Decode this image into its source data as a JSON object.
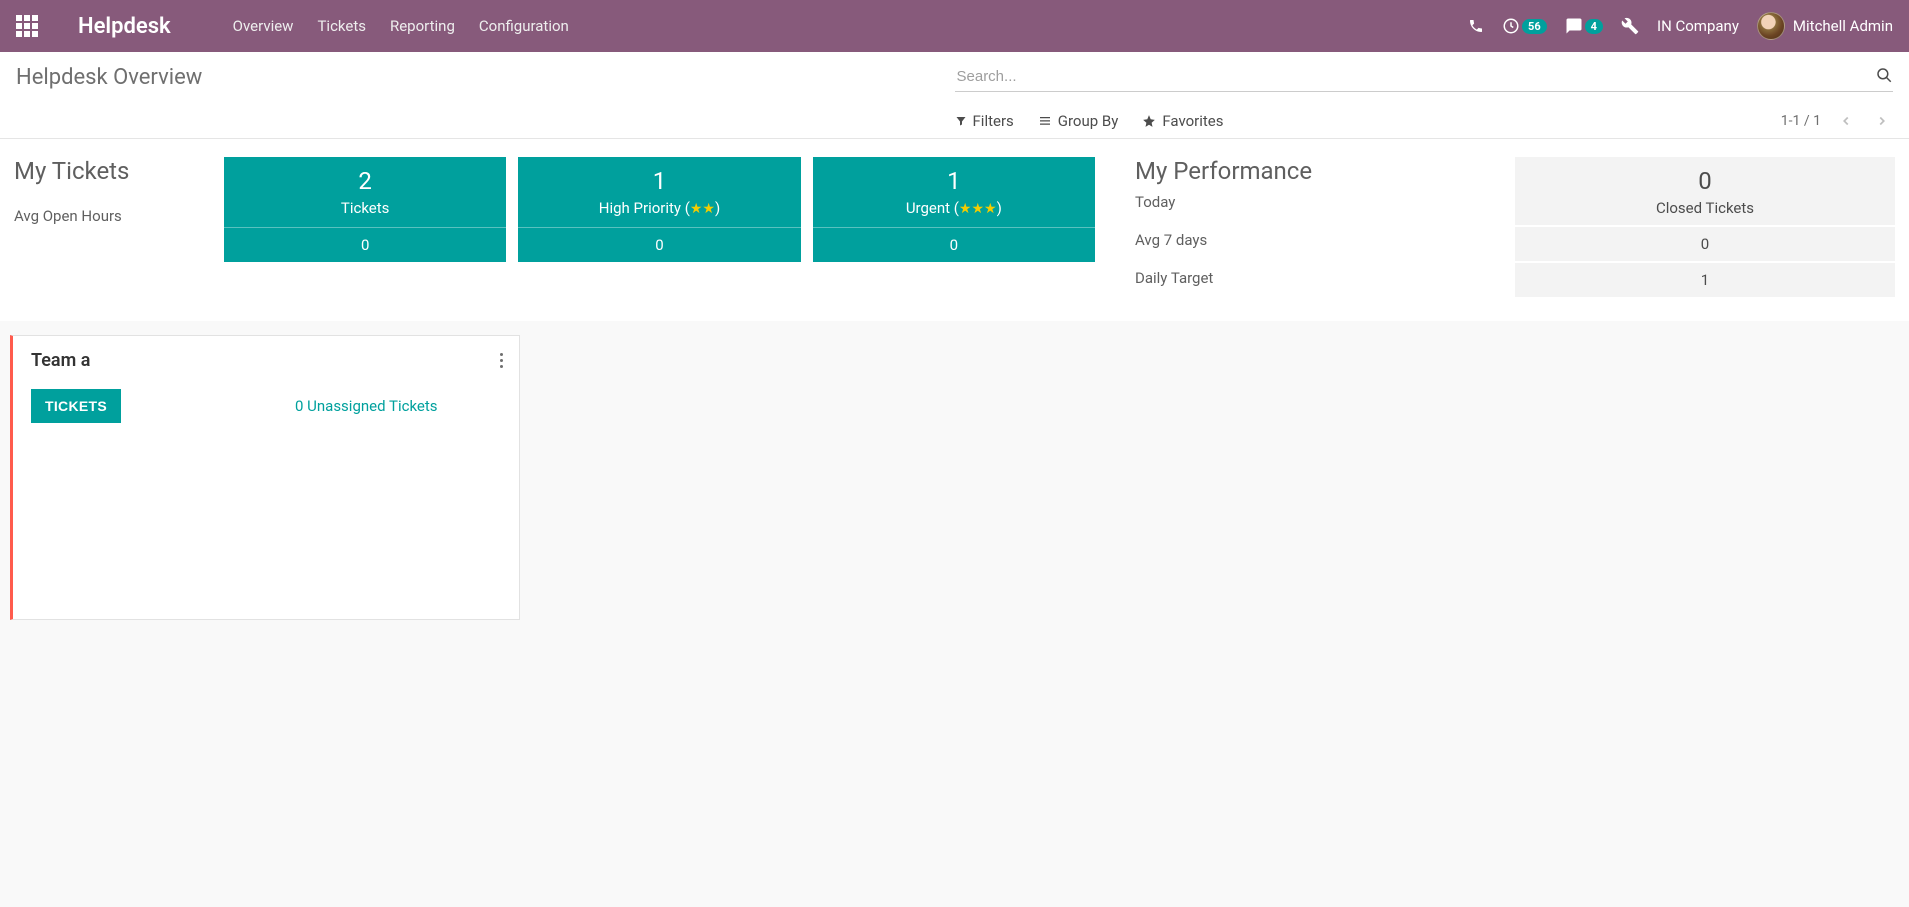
{
  "navbar": {
    "brand": "Helpdesk",
    "menu": [
      "Overview",
      "Tickets",
      "Reporting",
      "Configuration"
    ],
    "activity_count": "56",
    "message_count": "4",
    "company": "IN Company",
    "user": "Mitchell Admin"
  },
  "control_panel": {
    "title": "Helpdesk Overview",
    "search_placeholder": "Search...",
    "filters_label": "Filters",
    "groupby_label": "Group By",
    "favorites_label": "Favorites",
    "pager": "1-1 / 1"
  },
  "dashboard": {
    "my_tickets": {
      "heading": "My Tickets",
      "avg_open_label": "Avg Open Hours",
      "cards": [
        {
          "value": "2",
          "label": "Tickets",
          "bottom": "0",
          "stars": 0
        },
        {
          "value": "1",
          "label_prefix": "High Priority (",
          "label_suffix": ")",
          "bottom": "0",
          "stars": 2
        },
        {
          "value": "1",
          "label_prefix": "Urgent (",
          "label_suffix": ")",
          "bottom": "0",
          "stars": 3
        }
      ]
    },
    "performance": {
      "heading": "My Performance",
      "today_label": "Today",
      "avg7_label": "Avg 7 days",
      "target_label": "Daily Target",
      "closed_value": "0",
      "closed_label": "Closed Tickets",
      "avg7_value": "0",
      "target_value": "1"
    }
  },
  "kanban": {
    "team_name": "Team a",
    "tickets_btn": "TICKETS",
    "unassigned": "0 Unassigned Tickets"
  }
}
